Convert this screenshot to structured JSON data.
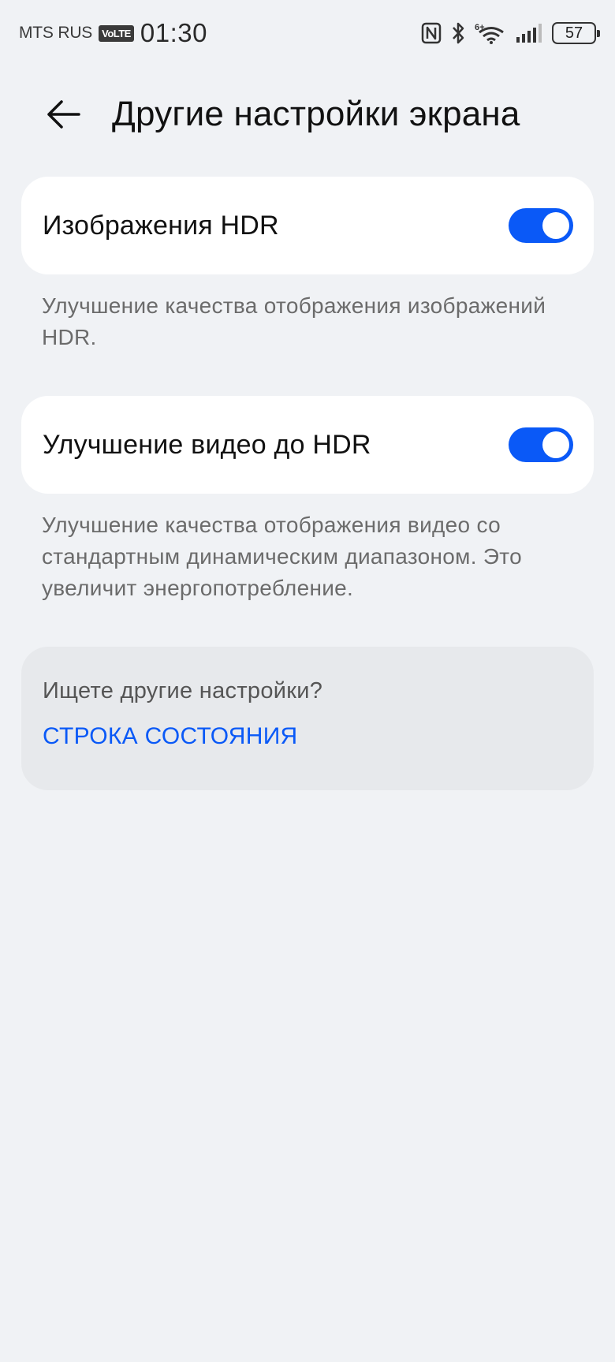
{
  "status_bar": {
    "carrier": "MTS RUS",
    "volte": "VoLTE",
    "time": "01:30",
    "icons": [
      "nfc-icon",
      "bluetooth-icon",
      "wifi-6-icon",
      "signal-icon"
    ],
    "battery": "57"
  },
  "header": {
    "title": "Другие настройки экрана"
  },
  "settings": [
    {
      "label": "Изображения HDR",
      "enabled": true,
      "description": "Улучшение качества отображения изображений HDR."
    },
    {
      "label": "Улучшение видео до HDR",
      "enabled": true,
      "description": "Улучшение качества отображения видео со стандартным динамическим диапазоном. Это увеличит энергопотребление."
    }
  ],
  "hint": {
    "text": "Ищете другие настройки?",
    "link": "СТРОКА СОСТОЯНИЯ"
  },
  "colors": {
    "accent": "#0a59f7",
    "background": "#f0f2f5",
    "card": "#ffffff"
  }
}
